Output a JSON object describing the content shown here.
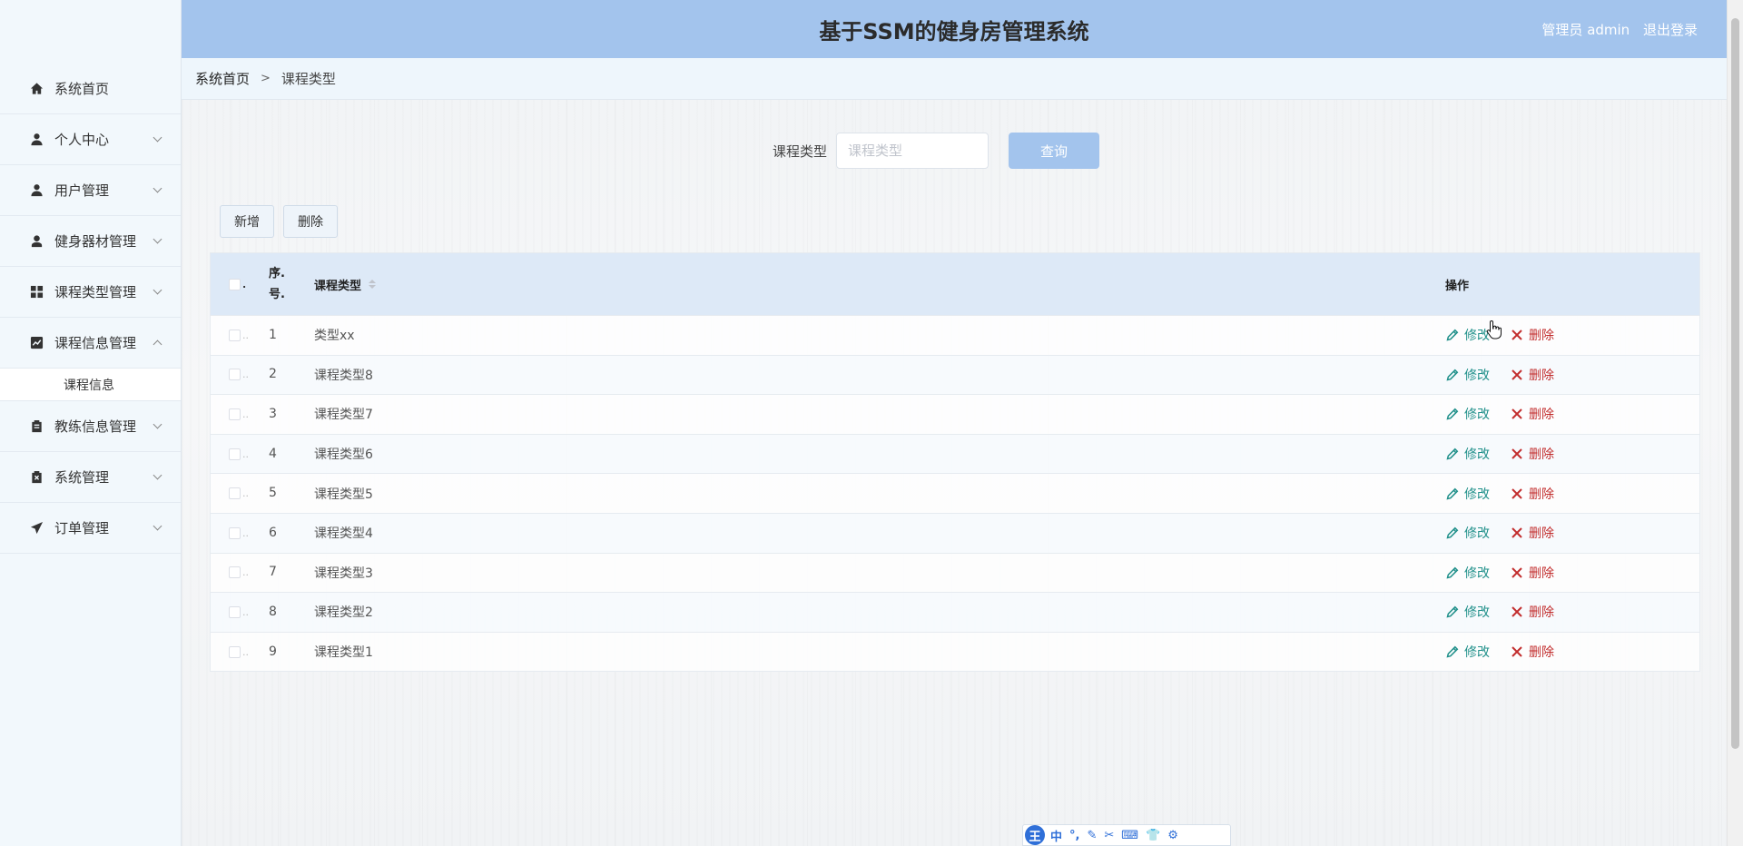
{
  "header": {
    "title": "基于SSM的健身房管理系统",
    "admin_label": "管理员 admin",
    "logout_label": "退出登录"
  },
  "sidebar": {
    "items": [
      {
        "label": "系统首页",
        "icon": "home-icon",
        "expandable": false
      },
      {
        "label": "个人中心",
        "icon": "person-icon",
        "expandable": true
      },
      {
        "label": "用户管理",
        "icon": "user-icon",
        "expandable": true
      },
      {
        "label": "健身器材管理",
        "icon": "person-bust-icon",
        "expandable": true
      },
      {
        "label": "课程类型管理",
        "icon": "grid-icon",
        "expandable": true
      },
      {
        "label": "课程信息管理",
        "icon": "chart-icon",
        "expandable": true,
        "expanded": true
      },
      {
        "label": "课程信息",
        "submenu": true
      },
      {
        "label": "教练信息管理",
        "icon": "clipboard-icon",
        "expandable": true
      },
      {
        "label": "系统管理",
        "icon": "clipboard-x-icon",
        "expandable": true
      },
      {
        "label": "订单管理",
        "icon": "send-icon",
        "expandable": true
      }
    ]
  },
  "breadcrumb": {
    "home": "系统首页",
    "separator": ">",
    "current": "课程类型"
  },
  "search": {
    "label": "课程类型",
    "placeholder": "课程类型",
    "value": "",
    "button": "查询"
  },
  "actions": {
    "add": "新增",
    "delete": "删除"
  },
  "table": {
    "headers": {
      "index": "序.\n号.",
      "index_line1": "序.",
      "index_line2": "号.",
      "type": "课程类型",
      "ops": "操作"
    },
    "rows": [
      {
        "index": "1",
        "type": "类型xx"
      },
      {
        "index": "2",
        "type": "课程类型8"
      },
      {
        "index": "3",
        "type": "课程类型7"
      },
      {
        "index": "4",
        "type": "课程类型6"
      },
      {
        "index": "5",
        "type": "课程类型5"
      },
      {
        "index": "6",
        "type": "课程类型4"
      },
      {
        "index": "7",
        "type": "课程类型3"
      },
      {
        "index": "8",
        "type": "课程类型2"
      },
      {
        "index": "9",
        "type": "课程类型1"
      }
    ],
    "edit_label": "修改",
    "delete_label": "删除"
  },
  "ime": {
    "logo": "王",
    "mode": "中",
    "punct": "°,"
  },
  "colors": {
    "header_bg": "#a3c4ed",
    "edit": "#20908a",
    "delete": "#c22d2d",
    "sidebar_bg": "#f2f8fc"
  }
}
